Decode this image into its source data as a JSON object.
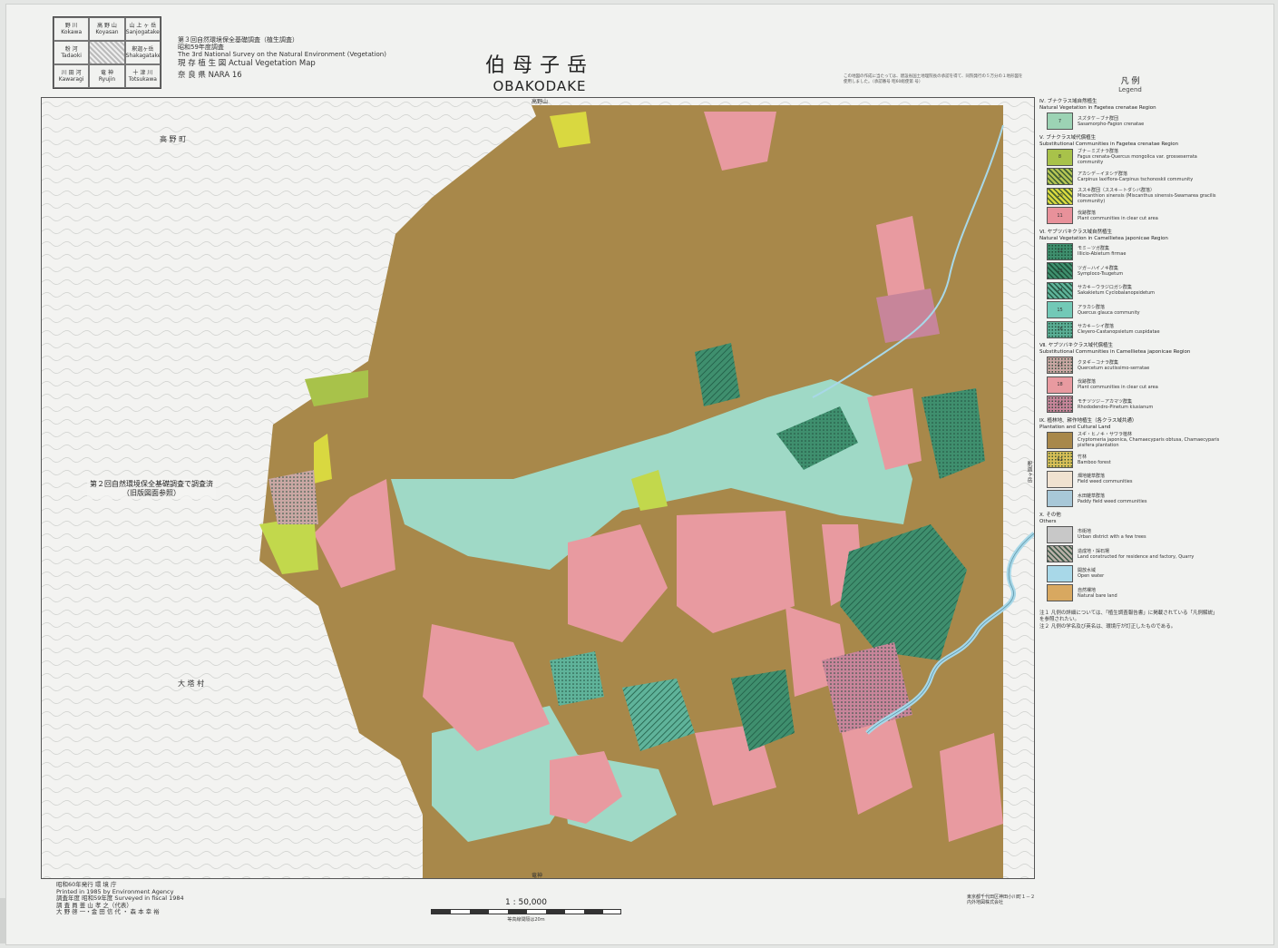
{
  "index_map": [
    [
      "野 川",
      "高 野 山",
      "山 上 ヶ 岳"
    ],
    [
      "Kokawa",
      "Koyasan",
      "Sanjogatake"
    ],
    [
      "粉 河",
      "",
      "釈迦ヶ岳"
    ],
    [
      "Tadaoki",
      "",
      "Shakagatake"
    ],
    [
      "川 田 河",
      "竜 神",
      "十 津 川"
    ],
    [
      "Kawaragi",
      "Ryujin",
      "Totsukawa"
    ]
  ],
  "header": {
    "survey": "第３回自然環境保全基礎調査（植生調査）",
    "fiscal": "昭和59年度調査",
    "survey_en": "The 3rd National Survey on the Natural Environment (Vegetation)",
    "map_type": "現 存 植 生 図 Actual Vegetation Map",
    "sheet": "奈 良 県  NARA 16"
  },
  "title": {
    "jp": "伯母子岳",
    "en": "OBAKODAKE"
  },
  "top_note": "この地図の作成に当たっては、建設省国土地理院長の承認を得て、同院発行の５万分の１地形図を使用しました。（承認番号 昭60総使第 号）",
  "map": {
    "top_edge_label": "高野山",
    "bottom_edge_label": "竜神",
    "right_edge_label": "釈迦ヶ岳",
    "survey_note": "第２回自然環境保全基礎調査で調査済\n（旧版図面参照）",
    "region_labels": [
      {
        "text": "高 野 町",
        "pos": "upper-left"
      },
      {
        "text": "大 塔 村",
        "pos": "lower-left"
      }
    ]
  },
  "legend": {
    "title": "凡 例",
    "title_en": "Legend",
    "groups": [
      {
        "heading": "Ⅳ. ブナクラス域自然植生",
        "heading_en": "Natural Vegetation in Fagetea crenatae Region",
        "items": [
          {
            "code": "7",
            "color": "#9cd3b4",
            "pattern": "none",
            "jp": "スズタケ－ブナ群団",
            "en": "Sasamorpho-Fagion crenatae"
          }
        ]
      },
      {
        "heading": "Ⅴ. ブナクラス域代償植生",
        "heading_en": "Substitutional Communities in Fagetea crenatae Region",
        "items": [
          {
            "code": "8",
            "color": "#a8c24a",
            "pattern": "none",
            "jp": "ブナ－ミズナラ群落",
            "en": "Fagus crenata-Quercus mongolica var. grosseserrata community"
          },
          {
            "code": "9",
            "color": "#b5c454",
            "pattern": "hatch",
            "jp": "アカシデ－イヌシデ群落",
            "en": "Carpinus laxiflora-Carpinus tschonoskii community"
          },
          {
            "code": "10",
            "color": "#d9d840",
            "pattern": "hatch",
            "jp": "ススキ群団（ススキ－トダシバ群落）",
            "en": "Miscanthion sinensis (Miscanthus sinensis-Swamarea gracilis community)"
          },
          {
            "code": "11",
            "color": "#e8919a",
            "pattern": "none",
            "jp": "伐跡群落",
            "en": "Plant communities in clear cut area"
          }
        ]
      },
      {
        "heading": "Ⅵ. ヤブツバキクラス域自然植生",
        "heading_en": "Natural Vegetation in Camellietea japonicae Region",
        "items": [
          {
            "code": "12",
            "color": "#3f8f6e",
            "pattern": "dots",
            "jp": "モミ－ツガ群集",
            "en": "Illicio-Abietum firmae"
          },
          {
            "code": "13",
            "color": "#3f8f6e",
            "pattern": "hatch",
            "jp": "ツガ－ハイノキ群集",
            "en": "Symploco-Tsugetum"
          },
          {
            "code": "14",
            "color": "#5fb39a",
            "pattern": "hatch",
            "jp": "サカキ－ウラジロガシ群集",
            "en": "Sakakietum Cyclobalanopsidetum"
          },
          {
            "code": "15",
            "color": "#72c9b7",
            "pattern": "none",
            "jp": "アラカシ群落",
            "en": "Quercus glauca community"
          },
          {
            "code": "16",
            "color": "#5bae96",
            "pattern": "dots",
            "jp": "サカキ－シイ群落",
            "en": "Cleyero-Castanopsietum cuspidatae"
          }
        ]
      },
      {
        "heading": "Ⅶ. ヤブツバキクラス域代償植生",
        "heading_en": "Substitutional Communities in Camellietea japonicae Region",
        "items": [
          {
            "code": "17",
            "color": "#c9a7a3",
            "pattern": "dots",
            "jp": "クヌギ－コナラ群集",
            "en": "Quercetum acutissimo-serratae"
          },
          {
            "code": "18",
            "color": "#e89aa0",
            "pattern": "none",
            "jp": "伐跡群落",
            "en": "Plant communities in clear cut area"
          },
          {
            "code": "19",
            "color": "#c7859a",
            "pattern": "dots",
            "jp": "モチツツジ－アカマツ群集",
            "en": "Rhododendro-Pinetum kiusianum"
          }
        ]
      },
      {
        "heading": "Ⅸ. 植林地、耕作地植生（各クラス域共通）",
        "heading_en": "Plantation and Cultural Land",
        "items": [
          {
            "code": "",
            "color": "#a8884a",
            "pattern": "none",
            "jp": "スギ・ヒノキ・サワラ植林",
            "en": "Cryptomeria japonica, Chamaecyparis obtusa, Chamaecyparis pisifera plantation"
          },
          {
            "code": "62",
            "color": "#d9c058",
            "pattern": "dots",
            "jp": "竹林",
            "en": "Bamboo forest"
          },
          {
            "code": "",
            "color": "#f0e2d0",
            "pattern": "none",
            "jp": "畑地雑草群落",
            "en": "Field weed communities"
          },
          {
            "code": "",
            "color": "#a8c8d8",
            "pattern": "none",
            "jp": "水田雑草群落",
            "en": "Paddy field weed communities"
          }
        ]
      },
      {
        "heading": "Ⅹ. その他",
        "heading_en": "Others",
        "items": [
          {
            "code": "",
            "color": "#c8c8c8",
            "pattern": "none",
            "jp": "市街地",
            "en": "Urban district with a few trees"
          },
          {
            "code": "",
            "color": "#b8b0a8",
            "pattern": "hatch",
            "jp": "造成地・採石場",
            "en": "Land constructed for residence and factory, Quarry"
          },
          {
            "code": "",
            "color": "#a8d8e8",
            "pattern": "none",
            "jp": "開放水域",
            "en": "Open water"
          },
          {
            "code": "",
            "color": "#d8a860",
            "pattern": "none",
            "jp": "自然裸地",
            "en": "Natural bare land"
          }
        ]
      }
    ],
    "notes": [
      "注１ 凡例の詳細については、「植生調査報告書」に掲載されている「凡例解説」を参照されたい。",
      "注２ 凡例の学名及び英名は、環境庁が訂正したものである。"
    ]
  },
  "footer": {
    "line1": "昭和60年発行      環 境 庁",
    "line2": "Printed in 1985 by Environment Agency",
    "line3": "調査年度  昭和59年度  Surveyed in fiscal 1984",
    "line4": "調 査 員  釜 山 孝 之（代表）",
    "line5": "            大 野 啓 一・金 田 信 代 ・ 森 本 幸 裕"
  },
  "scale": {
    "label": "1 : 50,000",
    "sub": "等高線間隔は20m"
  },
  "publisher": "東京都千代田区神田小川町１－２\n内外地図株式会社"
}
